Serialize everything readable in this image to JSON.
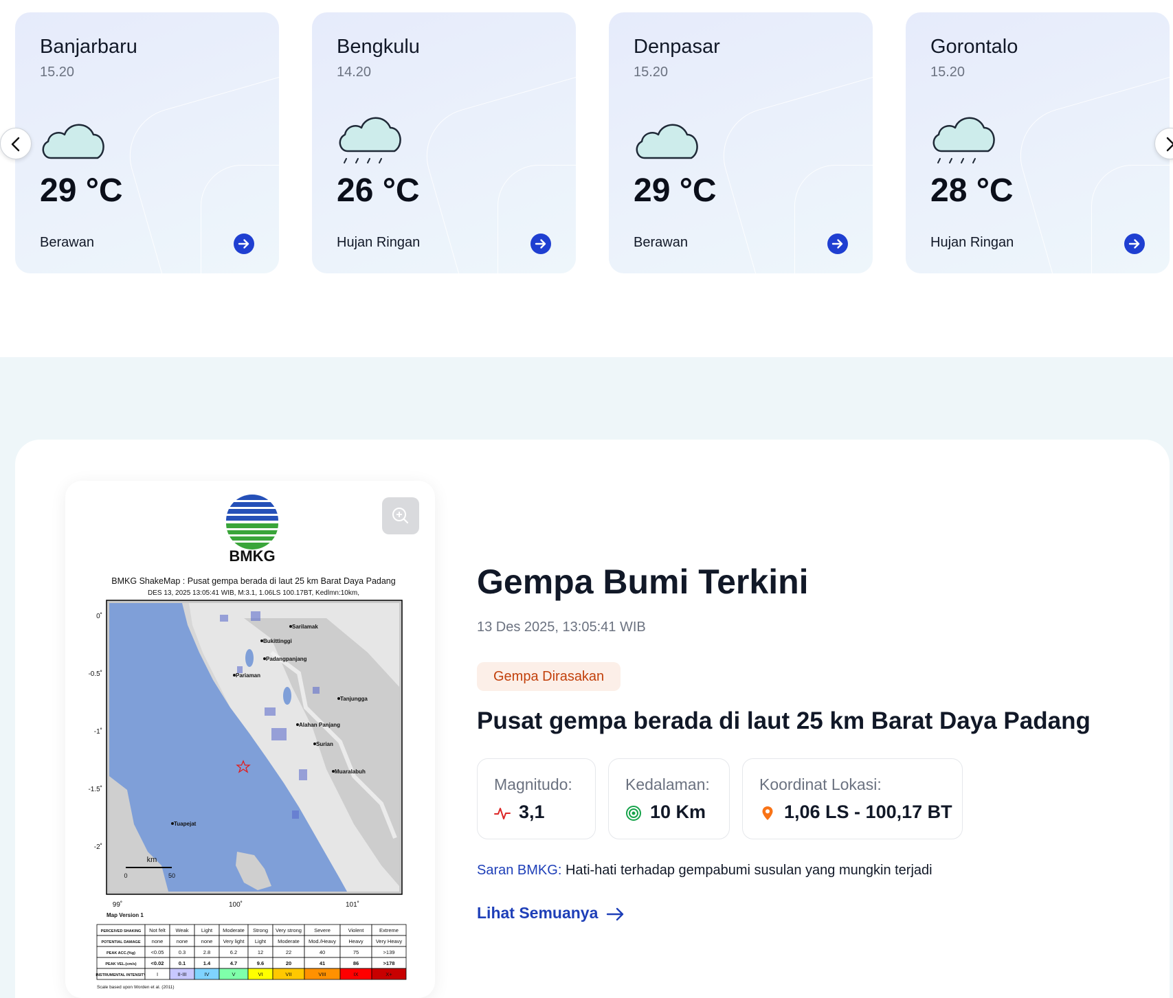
{
  "weather": {
    "cards": [
      {
        "city": "Banjarbaru",
        "time": "15.20",
        "temp": "29 °C",
        "condition": "Berawan",
        "icon": "cloud-icon"
      },
      {
        "city": "Bengkulu",
        "time": "14.20",
        "temp": "26 °C",
        "condition": "Hujan Ringan",
        "icon": "light-rain-icon"
      },
      {
        "city": "Denpasar",
        "time": "15.20",
        "temp": "29 °C",
        "condition": "Berawan",
        "icon": "cloud-icon"
      },
      {
        "city": "Gorontalo",
        "time": "15.20",
        "temp": "28 °C",
        "condition": "Hujan Ringan",
        "icon": "light-rain-icon"
      }
    ],
    "prev_icon": "chevron-left-icon",
    "next_icon": "chevron-right-icon"
  },
  "earthquake": {
    "title": "Gempa Bumi Terkini",
    "datetime": "13 Des 2025, 13:05:41 WIB",
    "badge": "Gempa Dirasakan",
    "headline": "Pusat gempa berada di laut 25 km Barat Daya Padang",
    "magnitude_label": "Magnitudo:",
    "magnitude_value": "3,1",
    "depth_label": "Kedalaman:",
    "depth_value": "10 Km",
    "coord_label": "Koordinat Lokasi:",
    "coord_value": "1,06 LS - 100,17 BT",
    "advice_label": "Saran BMKG:",
    "advice_text": "Hati-hati terhadap gempabumi susulan yang mungkin terjadi",
    "see_all": "Lihat Semuanya",
    "colors": {
      "accent": "#1e3fb8",
      "badge_bg": "#fcefe8",
      "badge_text": "#c2410c",
      "magnitude_icon": "#dc2626",
      "depth_icon": "#16a34a",
      "coord_icon": "#f97316"
    }
  },
  "shakemap": {
    "brand": "BMKG",
    "title": "BMKG ShakeMap : Pusat gempa berada di laut 25 km Barat Daya Padang",
    "subtitle": "DES 13, 2025 13:05:41 WIB, M:3.1, 1.06LS 100.17BT, Kedlmn:10km,",
    "lat_ticks": [
      "0˚",
      "-0.5˚",
      "-1˚",
      "-1.5˚",
      "-2˚"
    ],
    "lon_ticks": [
      "99˚",
      "100˚",
      "101˚"
    ],
    "places": [
      "Sarilamak",
      "Bukittinggi",
      "Padangpanjang",
      "Pariaman",
      "Tanjungga",
      "Alahan Panjang",
      "Surian",
      "Muaralabuh",
      "Tuapejat"
    ],
    "scale_unit": "km",
    "scale_zero": "0",
    "scale_fifty": "50",
    "version": "Map Version 1",
    "legend_rows": [
      [
        "PERCEIVED SHAKING",
        "Not felt",
        "Weak",
        "Light",
        "Moderate",
        "Strong",
        "Very strong",
        "Severe",
        "Violent",
        "Extreme"
      ],
      [
        "POTENTIAL DAMAGE",
        "none",
        "none",
        "none",
        "Very light",
        "Light",
        "Moderate",
        "Mod./Heavy",
        "Heavy",
        "Very Heavy"
      ],
      [
        "PEAK ACC.(%g)",
        "<0.05",
        "0.3",
        "2.8",
        "6.2",
        "12",
        "22",
        "40",
        "75",
        ">139"
      ],
      [
        "PEAK VEL.(cm/s)",
        "<0.02",
        "0.1",
        "1.4",
        "4.7",
        "9.6",
        "20",
        "41",
        "86",
        ">178"
      ],
      [
        "INSTRUMENTAL INTENSITY",
        "I",
        "II-III",
        "IV",
        "V",
        "VI",
        "VII",
        "VIII",
        "IX",
        "X+"
      ]
    ],
    "intensity_colors": [
      "#ffffff",
      "#c8c8ff",
      "#7fd3ff",
      "#7fffaa",
      "#ffff00",
      "#ffc800",
      "#ff9100",
      "#ff0000",
      "#c80000"
    ],
    "footnote": "Scale based upon Worden et al. (2011)"
  },
  "zoom_icon": "zoom-in-icon"
}
